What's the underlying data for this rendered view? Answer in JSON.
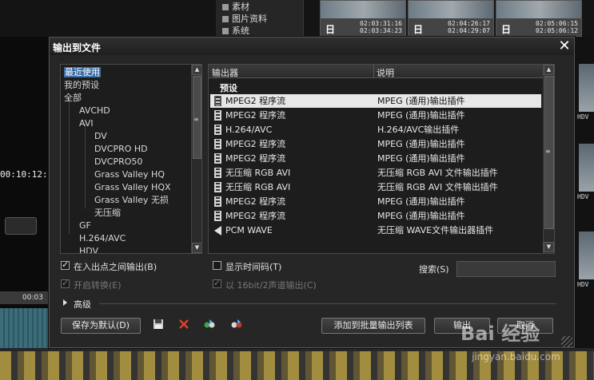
{
  "background": {
    "bin_items": [
      "素材",
      "图片资料",
      "系统"
    ],
    "thumbnails": [
      {
        "tc_in": "02:03:31:16",
        "tc_out": "02:03:34:23",
        "mark": "日"
      },
      {
        "tc_in": "02:04:26:17",
        "tc_out": "02:04:29:07",
        "mark": "日"
      },
      {
        "tc_in": "02:05:06:15",
        "tc_out": "02:05:06:12",
        "mark": "日"
      }
    ],
    "right_thumb_marks": [
      "HDV",
      "HDV",
      "HDV"
    ],
    "timecode_left": "00:10:12:",
    "ruler_label": "00:03"
  },
  "dialog": {
    "title": "输出到文件",
    "close_glyph": "✕",
    "tree": {
      "items": [
        {
          "label": "最近使用",
          "level": 0,
          "selected": true
        },
        {
          "label": "我的预设",
          "level": 0
        },
        {
          "label": "全部",
          "level": 0
        },
        {
          "label": "AVCHD",
          "level": 1
        },
        {
          "label": "AVI",
          "level": 1
        },
        {
          "label": "DV",
          "level": 2
        },
        {
          "label": "DVCPRO HD",
          "level": 2
        },
        {
          "label": "DVCPRO50",
          "level": 2
        },
        {
          "label": "Grass Valley HQ",
          "level": 2
        },
        {
          "label": "Grass Valley HQX",
          "level": 2
        },
        {
          "label": "Grass Valley 无损",
          "level": 2
        },
        {
          "label": "无压缩",
          "level": 2
        },
        {
          "label": "GF",
          "level": 1
        },
        {
          "label": "H.264/AVC",
          "level": 1
        },
        {
          "label": "HDV",
          "level": 1
        }
      ]
    },
    "list": {
      "columns": [
        "输出器",
        "说明"
      ],
      "group": "预设",
      "rows": [
        {
          "name": "MPEG2 程序流",
          "desc": "MPEG (通用)输出插件",
          "icon": "film-icon",
          "selected": true
        },
        {
          "name": "MPEG2 程序流",
          "desc": "MPEG (通用)输出插件",
          "icon": "film-icon"
        },
        {
          "name": "H.264/AVC",
          "desc": "H.264/AVC输出插件",
          "icon": "film-icon"
        },
        {
          "name": "MPEG2 程序流",
          "desc": "MPEG (通用)输出插件",
          "icon": "film-icon"
        },
        {
          "name": "MPEG2 程序流",
          "desc": "MPEG (通用)输出插件",
          "icon": "film-icon"
        },
        {
          "name": "无压缩 RGB AVI",
          "desc": "无压缩 RGB AVI 文件输出插件",
          "icon": "film-icon"
        },
        {
          "name": "无压缩 RGB AVI",
          "desc": "无压缩 RGB AVI 文件输出插件",
          "icon": "film-icon"
        },
        {
          "name": "MPEG2 程序流",
          "desc": "MPEG (通用)输出插件",
          "icon": "film-icon"
        },
        {
          "name": "MPEG2 程序流",
          "desc": "MPEG (通用)输出插件",
          "icon": "film-icon"
        },
        {
          "name": "PCM WAVE",
          "desc": "无压缩 WAVE文件输出器插件",
          "icon": "audio-icon"
        }
      ]
    },
    "options": {
      "in_out": {
        "label": "在入出点之间输出(B)",
        "checked": true,
        "enabled": true
      },
      "show_timecode": {
        "label": "显示时间码(T)",
        "checked": false,
        "enabled": true
      },
      "enable_convert": {
        "label": "开启转换(E)",
        "checked": true,
        "enabled": false
      },
      "bit16": {
        "label": "以 16bit/2声道输出(C)",
        "checked": true,
        "enabled": false
      }
    },
    "search": {
      "label": "搜索(S)",
      "value": ""
    },
    "advanced_label": "高级",
    "buttons": {
      "save_default": "保存为默认(D)",
      "add_batch": "添加到批量输出列表",
      "export": "输出",
      "cancel": "取消"
    },
    "toolbar_icons": [
      "save-icon",
      "delete-icon",
      "preset-import-icon",
      "preset-export-icon"
    ]
  },
  "watermark": {
    "text": "Bai 经验",
    "url_text": "jingyan.baidu.com"
  },
  "colors": {
    "selection": "#3a6ea5",
    "dialog_bg": "#262626",
    "delete_red": "#e0402a"
  }
}
